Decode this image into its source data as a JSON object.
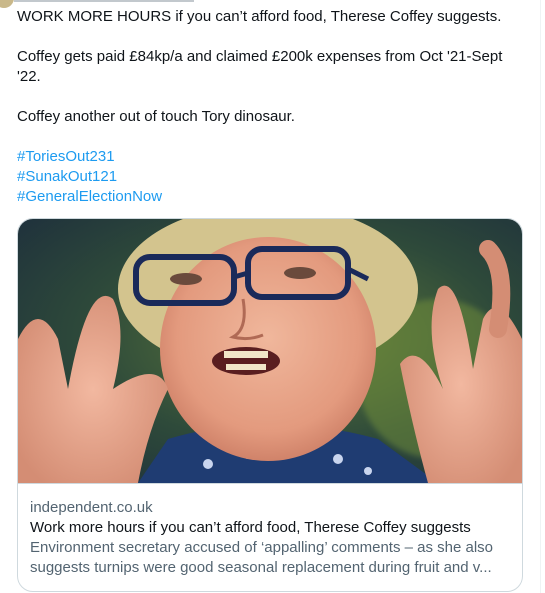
{
  "tweet": {
    "paragraphs": [
      "WORK MORE HOURS if you can’t afford food, Therese Coffey suggests.",
      "Coffey gets paid £84kp/a and claimed £200k expenses from Oct '21-Sept '22.",
      "Coffey another out of touch Tory dinosaur."
    ],
    "hashtags": [
      "#ToriesOut231",
      "#SunakOut121",
      "#GeneralElectionNow"
    ]
  },
  "card": {
    "domain": "independent.co.uk",
    "headline": "Work more hours if you can’t afford food, Therese Coffey suggests",
    "description_line1": "Environment secretary accused of ‘appalling’ comments – as she also",
    "description_line2": "suggests turnips were good seasonal replacement during fruit and v..."
  },
  "colors": {
    "link": "#1d9bf0",
    "text": "#0f1419",
    "secondary": "#536471",
    "border": "#cfd9de"
  }
}
